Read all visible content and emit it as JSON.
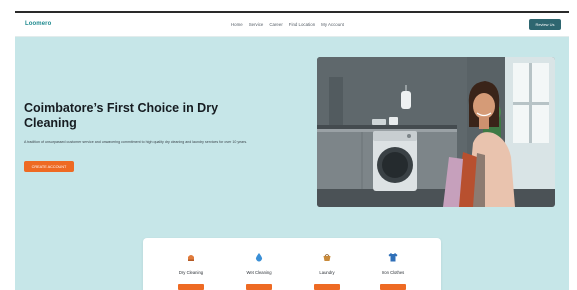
{
  "brand": {
    "logo": "Loomero",
    "accent": "#ee6a23",
    "primary_dark": "#2e6670",
    "page_bg": "#c6e6e8"
  },
  "nav": {
    "links": [
      "Home",
      "Service",
      "Career",
      "Find Location",
      "My Account"
    ],
    "cta_label": "Review Us"
  },
  "hero": {
    "title": "Coimbatore’s First Choice in Dry Cleaning",
    "description": "A tradition of unsurpassed customer service and unwavering commitment to high quality dry cleaning and laundry services for over 10 years.",
    "button_label": "CREATE ACCOUNT",
    "image_subject": "woman-holding-clothes-beside-washing-machine"
  },
  "services": [
    {
      "label": "Dry Cleaning",
      "icon": "dry-cleaning-icon"
    },
    {
      "label": "Wet Cleaning",
      "icon": "water-drop-icon"
    },
    {
      "label": "Laundry",
      "icon": "laundry-basket-icon"
    },
    {
      "label": "Iron Clothes",
      "icon": "shirt-icon"
    }
  ]
}
